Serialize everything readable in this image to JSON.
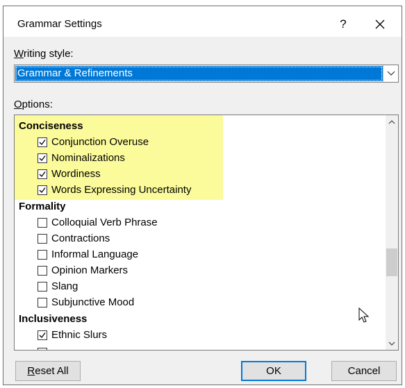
{
  "dialog": {
    "title": "Grammar Settings",
    "help_label": "?",
    "writing_style_label_accel": "W",
    "writing_style_label_rest": "riting style:",
    "writing_style_value": "Grammar & Refinements",
    "options_label_accel": "O",
    "options_label_rest": "ptions:"
  },
  "options": {
    "groups": [
      {
        "name": "Conciseness",
        "highlight_color": "#fbfb9b",
        "items": [
          {
            "label": "Conjunction Overuse",
            "checked": true
          },
          {
            "label": "Nominalizations",
            "checked": true
          },
          {
            "label": "Wordiness",
            "checked": true
          },
          {
            "label": "Words Expressing Uncertainty",
            "checked": true
          }
        ]
      },
      {
        "name": "Formality",
        "items": [
          {
            "label": "Colloquial Verb Phrase",
            "checked": false
          },
          {
            "label": "Contractions",
            "checked": false
          },
          {
            "label": "Informal Language",
            "checked": false
          },
          {
            "label": "Opinion Markers",
            "checked": false
          },
          {
            "label": "Slang",
            "checked": false
          },
          {
            "label": "Subjunctive Mood",
            "checked": false
          }
        ]
      },
      {
        "name": "Inclusiveness",
        "items": [
          {
            "label": "Ethnic Slurs",
            "checked": true
          }
        ]
      }
    ]
  },
  "buttons": {
    "reset_accel": "R",
    "reset_rest": "eset All",
    "ok": "OK",
    "cancel": "Cancel"
  },
  "colors": {
    "accent": "#0078d7",
    "highlight": "#fbfb9b",
    "dialog_bg": "#f0f0f0"
  },
  "icons": {
    "close": "close-icon",
    "dropdown": "chevron-down-icon",
    "scroll_up": "chevron-up-icon",
    "scroll_down": "chevron-down-icon",
    "checkmark": "checkmark-icon",
    "cursor": "mouse-pointer-icon"
  }
}
